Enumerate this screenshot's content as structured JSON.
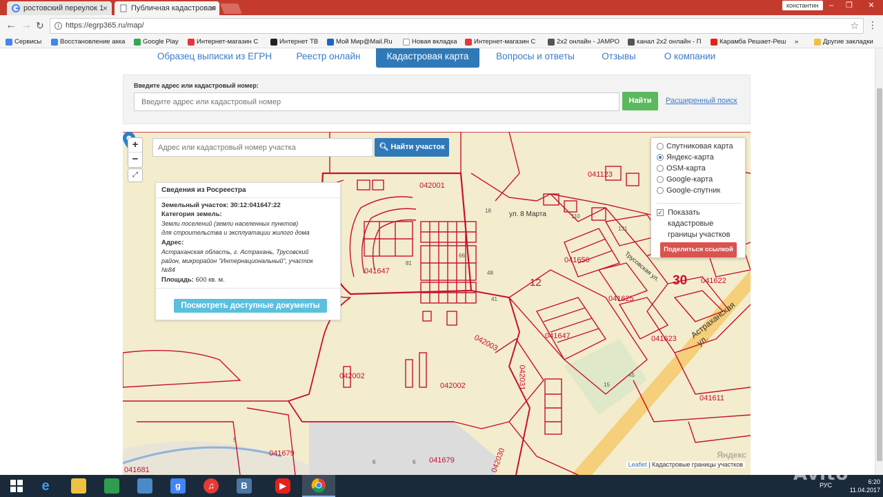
{
  "browser": {
    "tabs": [
      {
        "title": "ростовский переулок 1·",
        "active": false
      },
      {
        "title": "Публичная кадастровая",
        "active": true
      }
    ],
    "user": "константин",
    "url": "https://egrp365.ru/map/",
    "bookmarks": [
      "Сервисы",
      "Восстановление акка",
      "Google Play",
      "Интернет-магазин С",
      "Интернет ТВ",
      "Мой Мир@Mail.Ru",
      "Новая вкладка",
      "Интернет-магазин С",
      "2x2 онлайн - JAMPO",
      "канал 2x2 онлайн - П",
      "Карамба Решает-Реш",
      "»",
      "Другие закладки"
    ]
  },
  "site": {
    "nav": [
      {
        "label": "Образец выписки из ЕГРН",
        "active": false
      },
      {
        "label": "Реестр онлайн",
        "active": false
      },
      {
        "label": "Кадастровая карта",
        "active": true
      },
      {
        "label": "Вопросы и ответы",
        "active": false
      },
      {
        "label": "Отзывы",
        "active": false
      },
      {
        "label": "О компании",
        "active": false
      }
    ],
    "search": {
      "label": "Введите адрес или кадастровый номер:",
      "placeholder": "Введите адрес или кадастровый номер",
      "button": "Найти",
      "advanced": "Расширенный поиск"
    }
  },
  "map": {
    "zoom_in": "+",
    "zoom_out": "−",
    "fullscreen": "⤢",
    "search_placeholder": "Адрес или кадастровый номер участка",
    "search_button": "Найти участок",
    "info": {
      "title": "Сведения из Росреестра",
      "parcel_label": "Земельный участок:",
      "parcel_number": "30:12:041647:22",
      "category_label": "Категория земель:",
      "category_1": "Земли поселений (земли населенных пунктов)",
      "category_2": "для строительства и эксплуатации жилого дома",
      "address_label": "Адрес:",
      "address_1": "Астраханская область, г. Астрахань, Трусовский",
      "address_2": "район, микрорайон \"Интернациональный\", участок",
      "address_3": "№84",
      "area_label": "Площадь:",
      "area_value": "600 кв. м.",
      "docs_button": "Посмотреть доступные документы"
    },
    "layers": {
      "options": [
        {
          "label": "Спутниковая карта",
          "selected": false
        },
        {
          "label": "Яндекс-карта",
          "selected": true
        },
        {
          "label": "OSM-карта",
          "selected": false
        },
        {
          "label": "Google-карта",
          "selected": false
        },
        {
          "label": "Google-спутник",
          "selected": false
        }
      ],
      "show_borders_checked": true,
      "show_borders_label": "Показать кадастровые границы участков",
      "share_button": "Поделиться ссылкой"
    },
    "labels": {
      "q042001": "042001",
      "q041123": "041123",
      "q041647a": "041647",
      "q041650": "041650",
      "q041625": "041625",
      "q041622": "041622",
      "q041647b": "041647",
      "q041623": "041623",
      "q042003": "042003",
      "q042002a": "042002",
      "q042002b": "042002",
      "q042031": "042031",
      "q041611": "041611",
      "q041679a": "041679",
      "q041679b": "041679",
      "q042030": "042030",
      "q041681": "041681",
      "street1": "ул. 8 Марта",
      "street2": "Астраханская ул.",
      "street3": "Трусовская ул.",
      "num12": "12",
      "num30": "30",
      "h66": "66",
      "h15": "15",
      "h110": "110",
      "h131": "131",
      "h18": "18",
      "h45": "45",
      "h5": "5",
      "h6a": "6",
      "h6b": "6",
      "h41": "41",
      "h48": "48",
      "h81": "81"
    },
    "attribution_leaflet": "Leaflet",
    "attribution_rest": "| Кадастровые границы участков",
    "yandex": "Яндекс"
  },
  "taskbar": {
    "lang": "РУС",
    "time": "6:20",
    "date": "11.04.2017"
  },
  "watermark": "Avito",
  "colors": {
    "accent": "#2f79b9",
    "green": "#5cb85c",
    "red": "#d9534f",
    "parcel": "#c8102e",
    "map_bg": "#f3eccd"
  }
}
